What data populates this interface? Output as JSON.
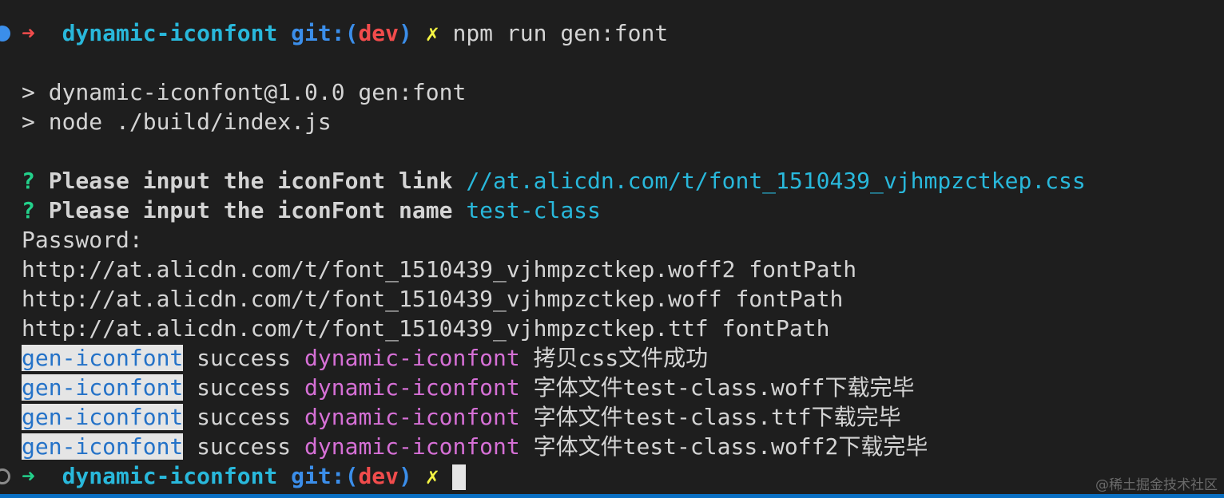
{
  "prompt_1": {
    "arrow": "➜",
    "dir": "dynamic-iconfont",
    "git": "git:(",
    "branch": "dev",
    "git_close": ")",
    "dirty": "✗",
    "command": "npm run gen:font"
  },
  "script_lines": [
    "> dynamic-iconfont@1.0.0 gen:font",
    "> node ./build/index.js"
  ],
  "questions": [
    {
      "mark": "?",
      "question": "Please input the iconFont link",
      "answer": "//at.alicdn.com/t/font_1510439_vjhmpzctkep.css"
    },
    {
      "mark": "?",
      "question": "Please input the iconFont name",
      "answer": "test-class"
    }
  ],
  "password_line": "Password:",
  "font_paths": [
    "http://at.alicdn.com/t/font_1510439_vjhmpzctkep.woff2 fontPath",
    "http://at.alicdn.com/t/font_1510439_vjhmpzctkep.woff fontPath",
    "http://at.alicdn.com/t/font_1510439_vjhmpzctkep.ttf fontPath"
  ],
  "log_lines": [
    {
      "tag": "gen-iconfont",
      "status": "success",
      "pkg": "dynamic-iconfont",
      "msg": "拷贝css文件成功"
    },
    {
      "tag": "gen-iconfont",
      "status": "success",
      "pkg": "dynamic-iconfont",
      "msg": "字体文件test-class.woff下载完毕"
    },
    {
      "tag": "gen-iconfont",
      "status": "success",
      "pkg": "dynamic-iconfont",
      "msg": "字体文件test-class.ttf下载完毕"
    },
    {
      "tag": "gen-iconfont",
      "status": "success",
      "pkg": "dynamic-iconfont",
      "msg": "字体文件test-class.woff2下载完毕"
    }
  ],
  "prompt_2": {
    "arrow": "➜",
    "dir": "dynamic-iconfont",
    "git": "git:(",
    "branch": "dev",
    "git_close": ")",
    "dirty": "✗"
  },
  "watermark": "@稀土掘金技术社区",
  "colors": {
    "background": "#1e1e1e",
    "foreground": "#d4d4d4",
    "prompt_arrow_error": "#f14c4c",
    "prompt_arrow_ok": "#23d18b",
    "dir": "#29b8db",
    "git": "#3b8eea",
    "branch": "#f14c4c",
    "dirty": "#f5f543",
    "question_mark": "#23d18b",
    "answer": "#29b8db",
    "tag_fg": "#2472c8",
    "tag_bg": "#e5e5e5",
    "pkg": "#d670d6"
  }
}
